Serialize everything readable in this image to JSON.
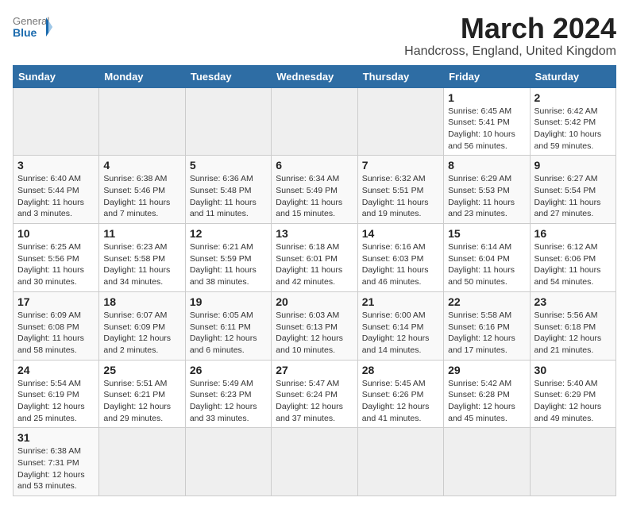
{
  "header": {
    "logo_general": "General",
    "logo_blue": "Blue",
    "title": "March 2024",
    "location": "Handcross, England, United Kingdom"
  },
  "days_of_week": [
    "Sunday",
    "Monday",
    "Tuesday",
    "Wednesday",
    "Thursday",
    "Friday",
    "Saturday"
  ],
  "weeks": [
    [
      {
        "day": "",
        "info": ""
      },
      {
        "day": "",
        "info": ""
      },
      {
        "day": "",
        "info": ""
      },
      {
        "day": "",
        "info": ""
      },
      {
        "day": "",
        "info": ""
      },
      {
        "day": "1",
        "info": "Sunrise: 6:45 AM\nSunset: 5:41 PM\nDaylight: 10 hours and 56 minutes."
      },
      {
        "day": "2",
        "info": "Sunrise: 6:42 AM\nSunset: 5:42 PM\nDaylight: 10 hours and 59 minutes."
      }
    ],
    [
      {
        "day": "3",
        "info": "Sunrise: 6:40 AM\nSunset: 5:44 PM\nDaylight: 11 hours and 3 minutes."
      },
      {
        "day": "4",
        "info": "Sunrise: 6:38 AM\nSunset: 5:46 PM\nDaylight: 11 hours and 7 minutes."
      },
      {
        "day": "5",
        "info": "Sunrise: 6:36 AM\nSunset: 5:48 PM\nDaylight: 11 hours and 11 minutes."
      },
      {
        "day": "6",
        "info": "Sunrise: 6:34 AM\nSunset: 5:49 PM\nDaylight: 11 hours and 15 minutes."
      },
      {
        "day": "7",
        "info": "Sunrise: 6:32 AM\nSunset: 5:51 PM\nDaylight: 11 hours and 19 minutes."
      },
      {
        "day": "8",
        "info": "Sunrise: 6:29 AM\nSunset: 5:53 PM\nDaylight: 11 hours and 23 minutes."
      },
      {
        "day": "9",
        "info": "Sunrise: 6:27 AM\nSunset: 5:54 PM\nDaylight: 11 hours and 27 minutes."
      }
    ],
    [
      {
        "day": "10",
        "info": "Sunrise: 6:25 AM\nSunset: 5:56 PM\nDaylight: 11 hours and 30 minutes."
      },
      {
        "day": "11",
        "info": "Sunrise: 6:23 AM\nSunset: 5:58 PM\nDaylight: 11 hours and 34 minutes."
      },
      {
        "day": "12",
        "info": "Sunrise: 6:21 AM\nSunset: 5:59 PM\nDaylight: 11 hours and 38 minutes."
      },
      {
        "day": "13",
        "info": "Sunrise: 6:18 AM\nSunset: 6:01 PM\nDaylight: 11 hours and 42 minutes."
      },
      {
        "day": "14",
        "info": "Sunrise: 6:16 AM\nSunset: 6:03 PM\nDaylight: 11 hours and 46 minutes."
      },
      {
        "day": "15",
        "info": "Sunrise: 6:14 AM\nSunset: 6:04 PM\nDaylight: 11 hours and 50 minutes."
      },
      {
        "day": "16",
        "info": "Sunrise: 6:12 AM\nSunset: 6:06 PM\nDaylight: 11 hours and 54 minutes."
      }
    ],
    [
      {
        "day": "17",
        "info": "Sunrise: 6:09 AM\nSunset: 6:08 PM\nDaylight: 11 hours and 58 minutes."
      },
      {
        "day": "18",
        "info": "Sunrise: 6:07 AM\nSunset: 6:09 PM\nDaylight: 12 hours and 2 minutes."
      },
      {
        "day": "19",
        "info": "Sunrise: 6:05 AM\nSunset: 6:11 PM\nDaylight: 12 hours and 6 minutes."
      },
      {
        "day": "20",
        "info": "Sunrise: 6:03 AM\nSunset: 6:13 PM\nDaylight: 12 hours and 10 minutes."
      },
      {
        "day": "21",
        "info": "Sunrise: 6:00 AM\nSunset: 6:14 PM\nDaylight: 12 hours and 14 minutes."
      },
      {
        "day": "22",
        "info": "Sunrise: 5:58 AM\nSunset: 6:16 PM\nDaylight: 12 hours and 17 minutes."
      },
      {
        "day": "23",
        "info": "Sunrise: 5:56 AM\nSunset: 6:18 PM\nDaylight: 12 hours and 21 minutes."
      }
    ],
    [
      {
        "day": "24",
        "info": "Sunrise: 5:54 AM\nSunset: 6:19 PM\nDaylight: 12 hours and 25 minutes."
      },
      {
        "day": "25",
        "info": "Sunrise: 5:51 AM\nSunset: 6:21 PM\nDaylight: 12 hours and 29 minutes."
      },
      {
        "day": "26",
        "info": "Sunrise: 5:49 AM\nSunset: 6:23 PM\nDaylight: 12 hours and 33 minutes."
      },
      {
        "day": "27",
        "info": "Sunrise: 5:47 AM\nSunset: 6:24 PM\nDaylight: 12 hours and 37 minutes."
      },
      {
        "day": "28",
        "info": "Sunrise: 5:45 AM\nSunset: 6:26 PM\nDaylight: 12 hours and 41 minutes."
      },
      {
        "day": "29",
        "info": "Sunrise: 5:42 AM\nSunset: 6:28 PM\nDaylight: 12 hours and 45 minutes."
      },
      {
        "day": "30",
        "info": "Sunrise: 5:40 AM\nSunset: 6:29 PM\nDaylight: 12 hours and 49 minutes."
      }
    ],
    [
      {
        "day": "31",
        "info": "Sunrise: 6:38 AM\nSunset: 7:31 PM\nDaylight: 12 hours and 53 minutes."
      },
      {
        "day": "",
        "info": ""
      },
      {
        "day": "",
        "info": ""
      },
      {
        "day": "",
        "info": ""
      },
      {
        "day": "",
        "info": ""
      },
      {
        "day": "",
        "info": ""
      },
      {
        "day": "",
        "info": ""
      }
    ]
  ]
}
